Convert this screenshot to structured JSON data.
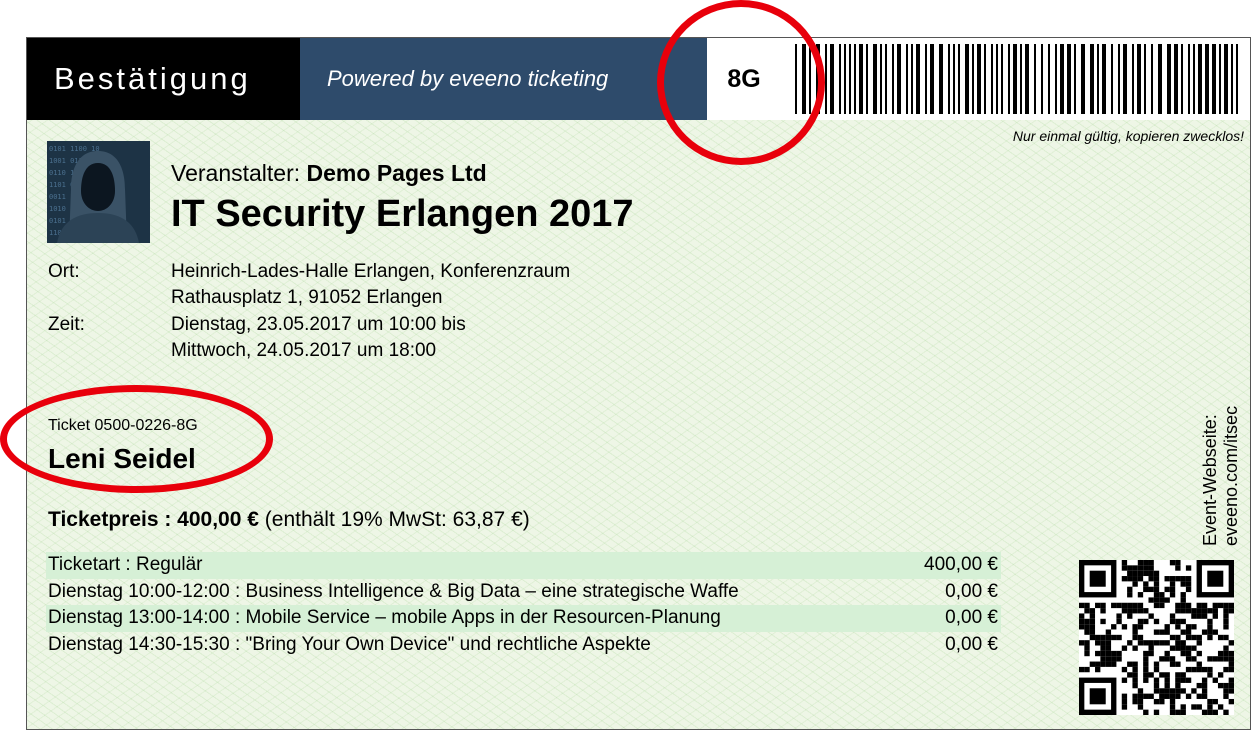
{
  "header": {
    "title": "Bestätigung",
    "powered": "Powered by eveeno ticketing",
    "code": "8G"
  },
  "note": "Nur einmal gültig, kopieren zwecklos!",
  "event": {
    "image_icon": "hooded-hacker-image",
    "organizer_label": "Veranstalter:",
    "organizer_name": "Demo Pages Ltd",
    "title": "IT Security Erlangen 2017"
  },
  "location": {
    "label": "Ort:",
    "line1": "Heinrich-Lades-Halle Erlangen, Konferenzraum",
    "line2": "Rathausplatz 1, 91052 Erlangen"
  },
  "time": {
    "label": "Zeit:",
    "line1": "Dienstag, 23.05.2017 um 10:00 bis",
    "line2": "Mittwoch, 24.05.2017 um 18:00"
  },
  "ticket": {
    "number": "Ticket 0500-0226-8G",
    "holder": "Leni Seidel"
  },
  "price": {
    "label": "Ticketpreis : 400,00 €",
    "tax": "(enthält 19% MwSt: 63,87 €)"
  },
  "items": [
    {
      "desc": "Ticketart : Regulär",
      "amount": "400,00 €"
    },
    {
      "desc": "Dienstag 10:00-12:00 : Business Intelligence & Big Data – eine strategische Waffe",
      "amount": "0,00 €"
    },
    {
      "desc": "Dienstag 13:00-14:00 : Mobile Service – mobile Apps in der Resourcen-Planung",
      "amount": "0,00 €"
    },
    {
      "desc": "Dienstag 14:30-15:30 : \"Bring Your Own Device\" und rechtliche Aspekte",
      "amount": "0,00 €"
    }
  ],
  "side": {
    "line1": "Event-Webseite:",
    "line2": "eveeno.com/itsec"
  },
  "colors": {
    "header_black": "#000000",
    "header_blue": "#2e4b6b",
    "highlight_red": "#e8000b",
    "row_shade": "#d6f0d6"
  }
}
